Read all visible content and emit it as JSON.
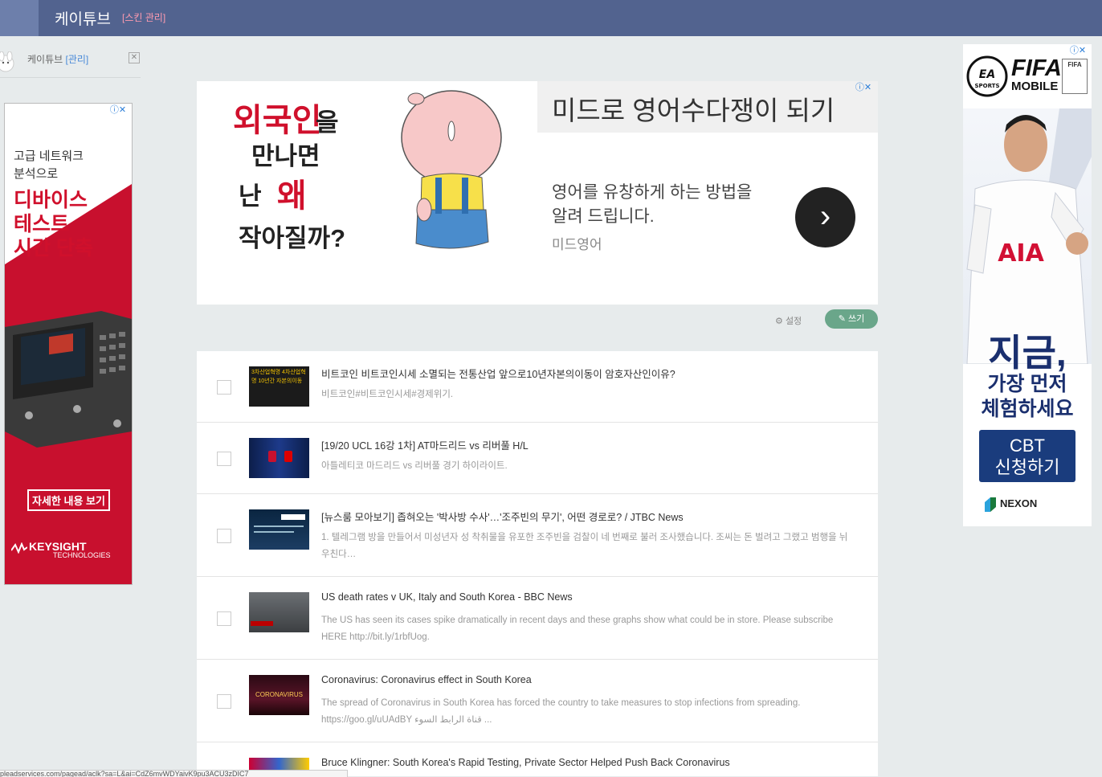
{
  "header": {
    "title": "케이튜브",
    "skin_link": "[스킨 관리]"
  },
  "profile": {
    "name": "케이튜브",
    "admin": "[관리]",
    "close": "✕"
  },
  "ad_left": {
    "line1": "고급 네트워크",
    "line2": "분석으로",
    "big": [
      "디바이스",
      "테스트",
      "시간 단축"
    ],
    "more": "자세한 내용 보기",
    "brand": "KEYSIGHT",
    "brand_sub": "TECHNOLOGIES"
  },
  "banner": {
    "k1": "외국인",
    "k1b": "을",
    "k2": "만나면",
    "k3a": "난",
    "k3b": "왜",
    "k4": "작아질까?",
    "headline": "미드로 영어수다쟁이 되기",
    "desc1": "영어를 유창하게 하는 방법을",
    "desc2": "알려 드립니다.",
    "source": "미드영어",
    "go": "›"
  },
  "actions": {
    "settings": "설정",
    "write": "쓰기"
  },
  "posts": [
    {
      "title": "비트코인 비트코인시세 소멸되는 전통산업 앞으로10년자본의이동이 암호자산인이유?",
      "summary": "비트코인#비트코인시세#경제위기.",
      "thumb_text": "3차산업혁명 4차산업혁명 10년간 자본의이동"
    },
    {
      "title": "[19/20 UCL 16강 1차] AT마드리드 vs 리버풀 H/L",
      "summary": "아틀레티코 마드리드 vs 리버풀 경기 하이라이트.",
      "thumb_text": ""
    },
    {
      "title": "[뉴스룸 모아보기] 좁혀오는 '박사방 수사'…'조주빈의 무기', 어떤 경로로? / JTBC News",
      "summary": "1. 텔레그램 방을 만들어서 미성년자 성 착취물을 유포한 조주빈을 검찰이 네 번째로 불러 조사했습니다. 조씨는 돈 벌려고 그랬고 범행을 뉘우친다…",
      "thumb_text": ""
    },
    {
      "title": "US death rates v UK, Italy and South Korea - BBC News",
      "summary": "The US has seen its cases spike dramatically in recent days and these graphs show what could be in store. Please subscribe HERE http://bit.ly/1rbfUog.",
      "thumb_text": ""
    },
    {
      "title": "Coronavirus: Coronavirus effect in South Korea",
      "summary": "The spread of Coronavirus in South Korea has forced the country to take measures to stop infections from spreading. https://goo.gl/uUAdBY قناة الرابط السوء ...",
      "thumb_text": "CORONAVIRUS"
    },
    {
      "title": "Bruce Klingner: South Korea's Rapid Testing, Private Sector Helped Push Back Coronavirus",
      "summary": "",
      "thumb_text": ""
    }
  ],
  "ad_right": {
    "fifa": "FIFA",
    "mobile": "MOBILE",
    "ea": "EA SPORTS",
    "jigeum": "지금,",
    "first": "가장 먼저",
    "try": "체험하세요",
    "cbt1": "CBT",
    "cbt2": "신청하기",
    "nexon": "NEXON",
    "jersey": "AIA"
  },
  "statusbar": "pleadservices.com/pagead/aclk?sa=L&ai=CdZ6mvWDYaivK9pu3ACU3zDIC7",
  "colors": {
    "header": "#52638f",
    "accent_green": "#6aa68a",
    "ad_red": "#c8102e"
  }
}
